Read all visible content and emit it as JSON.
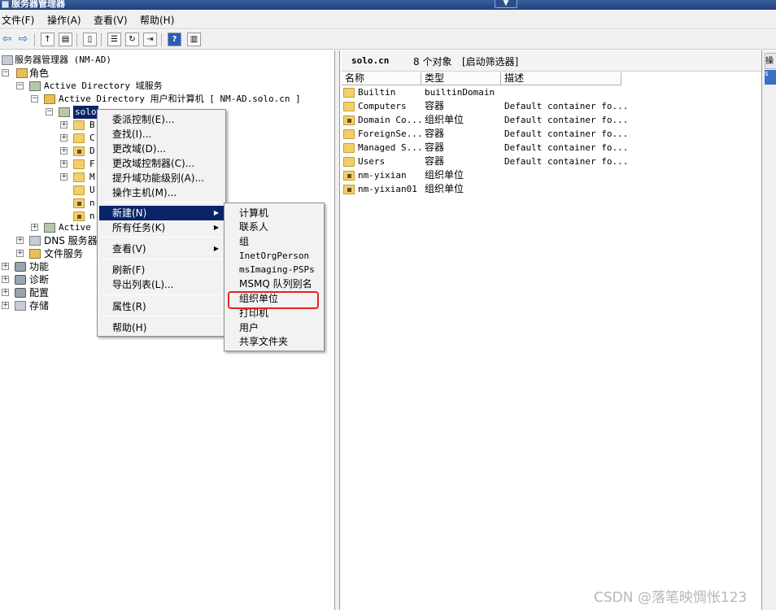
{
  "window": {
    "title": "服务器管理器"
  },
  "menubar": {
    "items": [
      "文件(F)",
      "操作(A)",
      "查看(V)",
      "帮助(H)"
    ]
  },
  "tree": {
    "root": "服务器管理器 (NM-AD)",
    "roles": "角色",
    "ad_ds": "Active Directory 域服务",
    "ad_users": "Active Directory 用户和计算机 [ NM-AD.solo.cn ]",
    "domain_node": "solo",
    "children_first_letters": [
      "B",
      "C",
      "D",
      "F",
      "M",
      "U",
      "n",
      "n"
    ],
    "ad_other": "Active D",
    "dns": "DNS 服务器",
    "file_services": "文件服务",
    "features": "功能",
    "diagnostics": "诊断",
    "config": "配置",
    "storage": "存储"
  },
  "list": {
    "header_title": "solo.cn",
    "header_count": "8 个对象",
    "header_filter": "[启动筛选器]",
    "columns": [
      "名称",
      "类型",
      "描述"
    ],
    "rows": [
      {
        "name": "Builtin",
        "type": "builtinDomain",
        "desc": "",
        "icon": "folder"
      },
      {
        "name": "Computers",
        "type": "容器",
        "desc": "Default container fo...",
        "icon": "folder"
      },
      {
        "name": "Domain Co...",
        "type": "组织单位",
        "desc": "Default container fo...",
        "icon": "ou"
      },
      {
        "name": "ForeignSe...",
        "type": "容器",
        "desc": "Default container fo...",
        "icon": "folder"
      },
      {
        "name": "Managed S...",
        "type": "容器",
        "desc": "Default container fo...",
        "icon": "folder"
      },
      {
        "name": "Users",
        "type": "容器",
        "desc": "Default container fo...",
        "icon": "folder"
      },
      {
        "name": "nm-yixian",
        "type": "组织单位",
        "desc": "",
        "icon": "ou"
      },
      {
        "name": "nm-yixian01",
        "type": "组织单位",
        "desc": "",
        "icon": "ou"
      }
    ]
  },
  "context_menu": {
    "items": [
      "委派控制(E)...",
      "查找(I)...",
      "更改域(D)...",
      "更改域控制器(C)...",
      "提升域功能级别(A)...",
      "操作主机(M)..."
    ],
    "new": "新建(N)",
    "all_tasks": "所有任务(K)",
    "view": "查看(V)",
    "refresh": "刷新(F)",
    "export": "导出列表(L)...",
    "properties": "属性(R)",
    "help": "帮助(H)"
  },
  "submenu": {
    "items": [
      "计算机",
      "联系人",
      "组",
      "InetOrgPerson",
      "msImaging-PSPs",
      "MSMQ 队列别名",
      "组织单位",
      "打印机",
      "用户",
      "共享文件夹"
    ],
    "highlighted": "组织单位"
  },
  "action_pane": {
    "header": "操",
    "selected": "s"
  },
  "watermark": "CSDN @落笔映惆怅123"
}
